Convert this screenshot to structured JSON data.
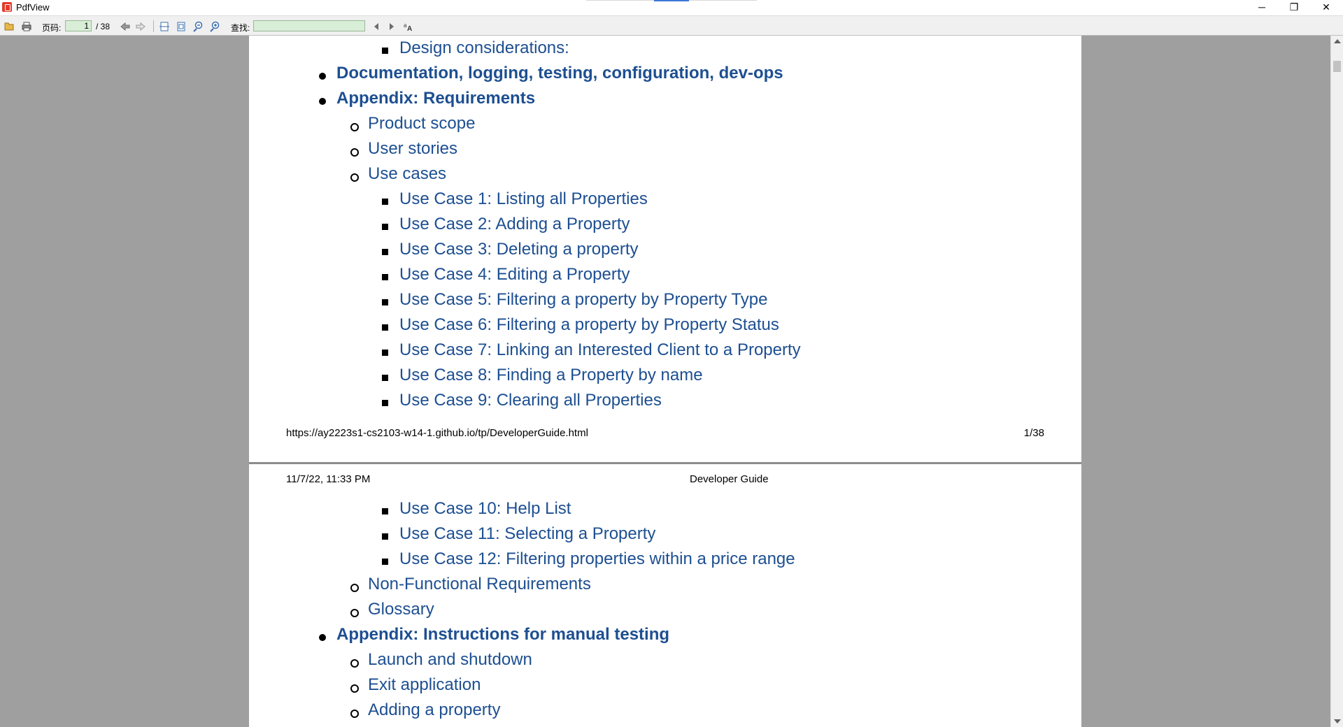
{
  "window": {
    "title": "PdfView",
    "minimize": "─",
    "restore": "❐",
    "close": "✕"
  },
  "toolbar": {
    "page_label": "页码:",
    "page_current": "1",
    "page_total": "/ 38",
    "search_label": "查找:",
    "search_value": ""
  },
  "page1": {
    "items": [
      {
        "level": 3,
        "text": "Design considerations:"
      },
      {
        "level": 1,
        "text": "Documentation, logging, testing, configuration, dev-ops"
      },
      {
        "level": 1,
        "text": "Appendix: Requirements"
      },
      {
        "level": 2,
        "text": "Product scope"
      },
      {
        "level": 2,
        "text": "User stories"
      },
      {
        "level": 2,
        "text": "Use cases"
      },
      {
        "level": 3,
        "text": "Use Case 1: Listing all Properties"
      },
      {
        "level": 3,
        "text": "Use Case 2: Adding a Property"
      },
      {
        "level": 3,
        "text": "Use Case 3: Deleting a property"
      },
      {
        "level": 3,
        "text": "Use Case 4: Editing a Property"
      },
      {
        "level": 3,
        "text": "Use Case 5: Filtering a property by Property Type"
      },
      {
        "level": 3,
        "text": "Use Case 6: Filtering a property by Property Status"
      },
      {
        "level": 3,
        "text": "Use Case 7: Linking an Interested Client to a Property"
      },
      {
        "level": 3,
        "text": "Use Case 8: Finding a Property by name"
      },
      {
        "level": 3,
        "text": "Use Case 9: Clearing all Properties"
      }
    ],
    "footer_url": "https://ay2223s1-cs2103-w14-1.github.io/tp/DeveloperGuide.html",
    "footer_page": "1/38"
  },
  "page2": {
    "header_date": "11/7/22, 11:33 PM",
    "header_title": "Developer Guide",
    "items": [
      {
        "level": 3,
        "text": "Use Case 10: Help List"
      },
      {
        "level": 3,
        "text": "Use Case 11: Selecting a Property"
      },
      {
        "level": 3,
        "text": "Use Case 12: Filtering properties within a price range"
      },
      {
        "level": 2,
        "text": "Non-Functional Requirements"
      },
      {
        "level": 2,
        "text": "Glossary"
      },
      {
        "level": 1,
        "text": "Appendix: Instructions for manual testing"
      },
      {
        "level": 2,
        "text": "Launch and shutdown"
      },
      {
        "level": 2,
        "text": "Exit application"
      },
      {
        "level": 2,
        "text": "Adding a property"
      }
    ]
  },
  "colors": {
    "link": "#1d4f91",
    "viewer_background": "#9f9f9f"
  },
  "icons": [
    "pdf-app-icon",
    "open-file-icon",
    "print-icon",
    "prev-page-icon",
    "next-page-icon",
    "fit-page-icon",
    "fit-width-icon",
    "zoom-out-icon",
    "zoom-in-icon",
    "find-prev-icon",
    "find-next-icon",
    "match-case-icon"
  ]
}
